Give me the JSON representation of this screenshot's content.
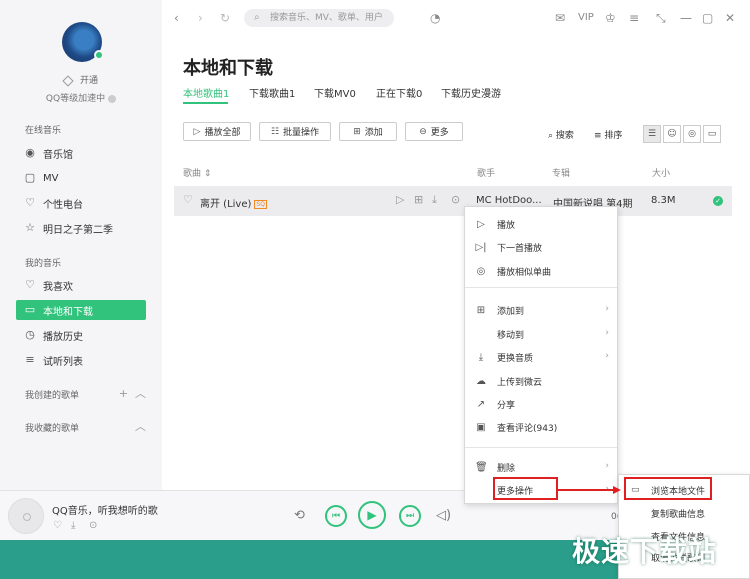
{
  "colors": {
    "accent": "#31c27c",
    "highlight": "#e02020",
    "sidebar_bg": "#f5f5f7"
  },
  "sidebar": {
    "vip_label": "开通",
    "level_text": "QQ等级加速中",
    "online_title": "在线音乐",
    "online_items": [
      {
        "label": "音乐馆",
        "icon": "music-hall-icon"
      },
      {
        "label": "MV",
        "icon": "mv-icon"
      },
      {
        "label": "个性电台",
        "icon": "radio-icon"
      },
      {
        "label": "明日之子第二季",
        "icon": "star-icon"
      }
    ],
    "my_title": "我的音乐",
    "my_items": [
      {
        "label": "我喜欢",
        "icon": "heart-icon"
      },
      {
        "label": "本地和下载",
        "icon": "monitor-icon"
      },
      {
        "label": "播放历史",
        "icon": "clock-icon"
      },
      {
        "label": "试听列表",
        "icon": "playlist-icon"
      }
    ],
    "created_title": "我创建的歌单",
    "collected_title": "我收藏的歌单"
  },
  "topbar": {
    "search_placeholder": "搜索音乐、MV、歌单、用户",
    "vip": "VIP"
  },
  "page": {
    "title": "本地和下载",
    "tabs": [
      "本地歌曲1",
      "下载歌曲1",
      "下载MV0",
      "正在下载0",
      "下载历史漫游"
    ]
  },
  "toolbar": {
    "play_all": "播放全部",
    "batch": "批量操作",
    "add": "添加",
    "more": "更多",
    "search": "搜索",
    "sort": "排序"
  },
  "table": {
    "headers": {
      "song": "歌曲",
      "artist": "歌手",
      "album": "专辑",
      "size": "大小"
    },
    "rows": [
      {
        "title": "离开 (Live)",
        "tag": "SQ",
        "artist": "MC HotDoo...",
        "album": "中国新说唱 第4期",
        "size": "8.3M"
      }
    ]
  },
  "context_menu": {
    "items": [
      {
        "label": "播放",
        "icon": "play-icon"
      },
      {
        "label": "下一首播放",
        "icon": "next-play-icon"
      },
      {
        "label": "播放相似单曲",
        "icon": "similar-icon"
      },
      {
        "label": "添加到",
        "icon": "add-to-icon"
      },
      {
        "label": "移动到",
        "icon": ""
      },
      {
        "label": "更换音质",
        "icon": "download-icon"
      },
      {
        "label": "上传到微云",
        "icon": "cloud-icon"
      },
      {
        "label": "分享",
        "icon": "share-icon"
      },
      {
        "label": "查看评论(943)",
        "icon": "comment-icon"
      },
      {
        "label": "删除",
        "icon": "trash-icon"
      },
      {
        "label": "更多操作",
        "icon": ""
      }
    ],
    "submenu": [
      {
        "label": "浏览本地文件",
        "icon": "folder-icon"
      },
      {
        "label": "复制歌曲信息"
      },
      {
        "label": "查看文件信息"
      },
      {
        "label": "取消关联歌词"
      }
    ]
  },
  "player": {
    "now_playing": "QQ音乐，听我想听的歌",
    "time_fragment": "0("
  },
  "watermark": "极速下载站"
}
